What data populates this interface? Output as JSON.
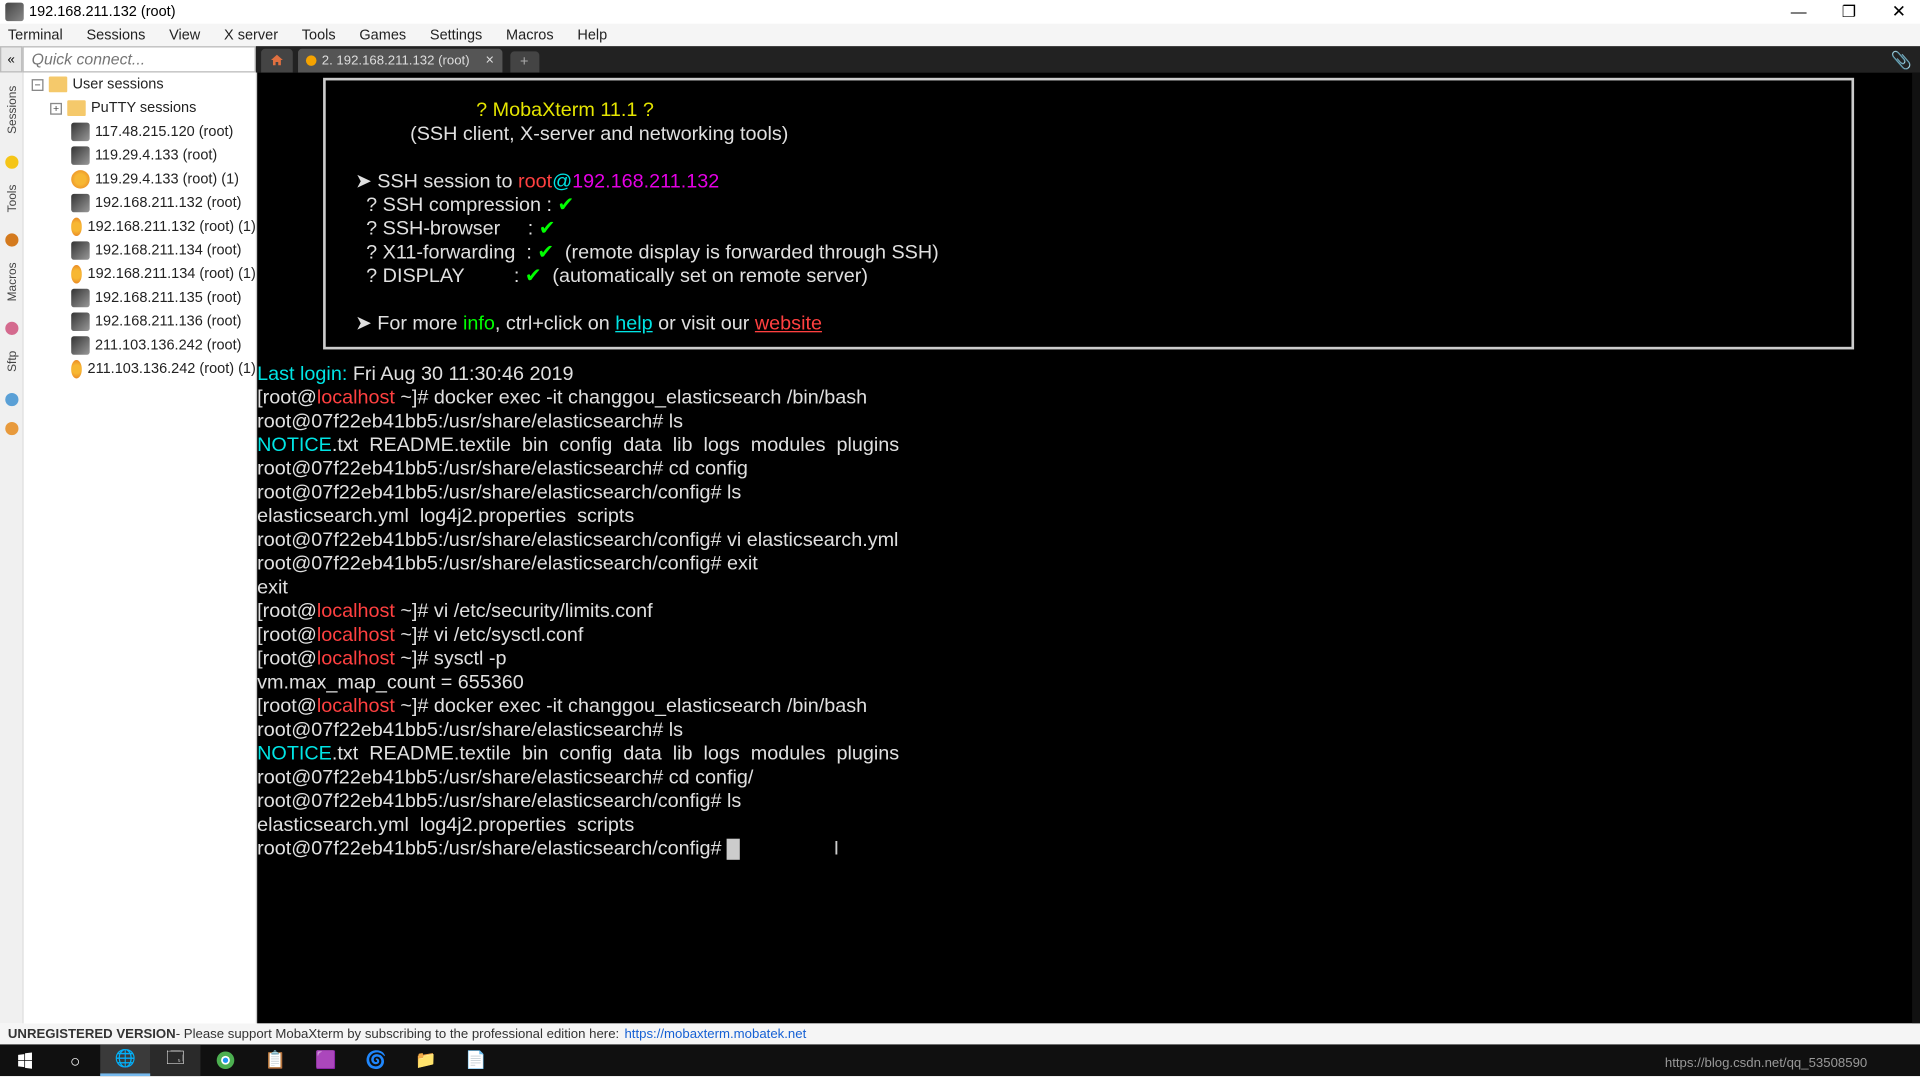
{
  "window": {
    "title": "192.168.211.132 (root)"
  },
  "menu": [
    "Terminal",
    "Sessions",
    "View",
    "X server",
    "Tools",
    "Games",
    "Settings",
    "Macros",
    "Help"
  ],
  "quickconnect": {
    "placeholder": "Quick connect..."
  },
  "tabs": {
    "active": "2. 192.168.211.132 (root)"
  },
  "leftstrip": [
    "Sessions",
    "Tools",
    "Macros",
    "Sftp"
  ],
  "sessions": {
    "root": "User sessions",
    "putty": "PuTTY sessions",
    "items": [
      "117.48.215.120 (root)",
      "119.29.4.133 (root)",
      "119.29.4.133 (root) (1)",
      "192.168.211.132 (root)",
      "192.168.211.132 (root) (1)",
      "192.168.211.134 (root)",
      "192.168.211.134 (root) (1)",
      "192.168.211.135 (root)",
      "192.168.211.136 (root)",
      "211.103.136.242 (root)",
      "211.103.136.242 (root) (1)"
    ]
  },
  "banner": {
    "title": "? MobaXterm 11.1 ?",
    "subtitle": "(SSH client, X-server and networking tools)",
    "session_prefix": "SSH session to ",
    "session_user": "root",
    "session_at": "@",
    "session_host": "192.168.211.132",
    "rows": [
      {
        "label": "SSH compression",
        "check": true,
        "note": ""
      },
      {
        "label": "SSH-browser",
        "check": true,
        "note": ""
      },
      {
        "label": "X11-forwarding",
        "check": true,
        "note": "(remote display is forwarded through SSH)"
      },
      {
        "label": "DISPLAY",
        "check": true,
        "note": "(automatically set on remote server)"
      }
    ],
    "more_prefix": "For more ",
    "more_info": "info",
    "more_mid": ", ctrl+click on ",
    "more_help": "help",
    "more_mid2": " or visit our ",
    "more_site": "website"
  },
  "term": {
    "lastlogin_label": "Last login:",
    "lastlogin": "Fri Aug 30 11:30:46 2019",
    "localhost": "localhost",
    "rootpfx": "[root@",
    "rootsfx": " ~]# ",
    "cmd1": "docker exec -it changgou_elasticsearch /bin/bash",
    "p_es": "root@07f22eb41bb5:/usr/share/elasticsearch# ",
    "p_cfg": "root@07f22eb41bb5:/usr/share/elasticsearch/config# ",
    "ls": "ls",
    "ls_out_notice": "NOTICE",
    "ls_out_rest": ".txt  README.textile  bin  config  data  lib  logs  modules  plugins",
    "cd_config": "cd config",
    "cd_config2": "cd config/",
    "ls_cfg_out": "elasticsearch.yml  log4j2.properties  scripts",
    "vi_es": "vi elasticsearch.yml",
    "exit": "exit",
    "exit2": "exit",
    "vi_limits": "vi /etc/security/limits.conf",
    "vi_sysctl": "vi /etc/sysctl.conf",
    "sysctlp": "sysctl -p",
    "sysctl_out": "vm.max_map_count = 655360"
  },
  "status": {
    "bold": "UNREGISTERED VERSION",
    "text": " -  Please support MobaXterm by subscribing to the professional edition here:",
    "link": "https://mobaxterm.mobatek.net"
  },
  "watermark": "https://blog.csdn.net/qq_53508590"
}
